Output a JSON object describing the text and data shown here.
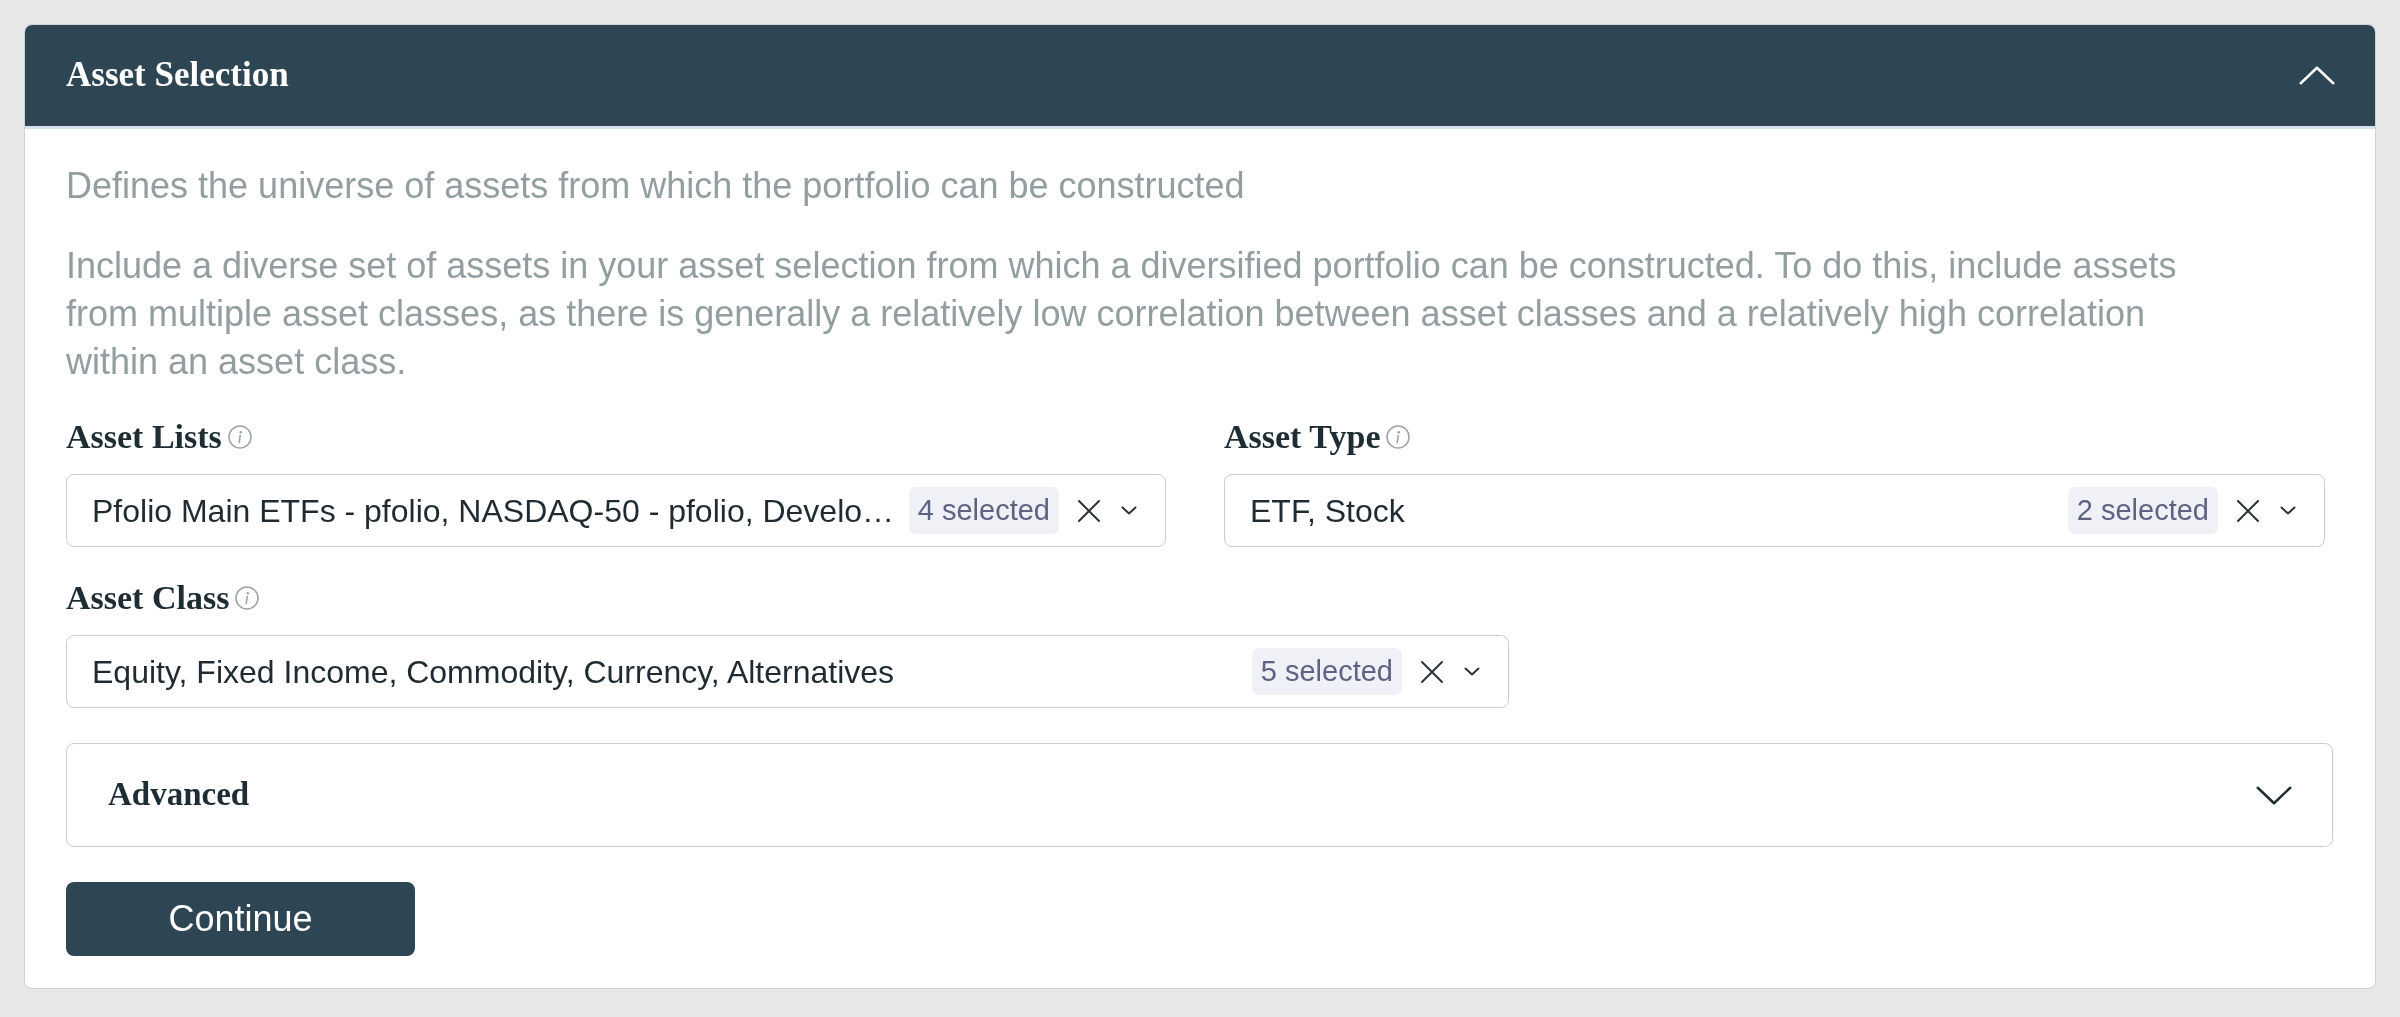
{
  "panel": {
    "title": "Asset Selection",
    "expanded": true
  },
  "description": "Defines the universe of assets from which the portfolio can be constructed",
  "guidance": "Include a diverse set of assets in your asset selection from which a diversified portfolio can be constructed. To do this, include assets from multiple asset classes, as there is generally a relatively low correlation between asset classes and a relatively high correlation within an asset class.",
  "fields": [
    {
      "label": "Asset Lists",
      "value": "Pfolio Main ETFs - pfolio, NASDAQ-50 - pfolio, Develo…",
      "count": "4 selected"
    },
    {
      "label": "Asset Type",
      "value": "ETF, Stock",
      "count": "2 selected"
    },
    {
      "label": "Asset Class",
      "value": "Equity, Fixed Income, Commodity, Currency, Alternatives",
      "count": "5 selected"
    }
  ],
  "advanced": {
    "title": "Advanced",
    "expanded": false
  },
  "continue_button": {
    "label": "Continue"
  }
}
